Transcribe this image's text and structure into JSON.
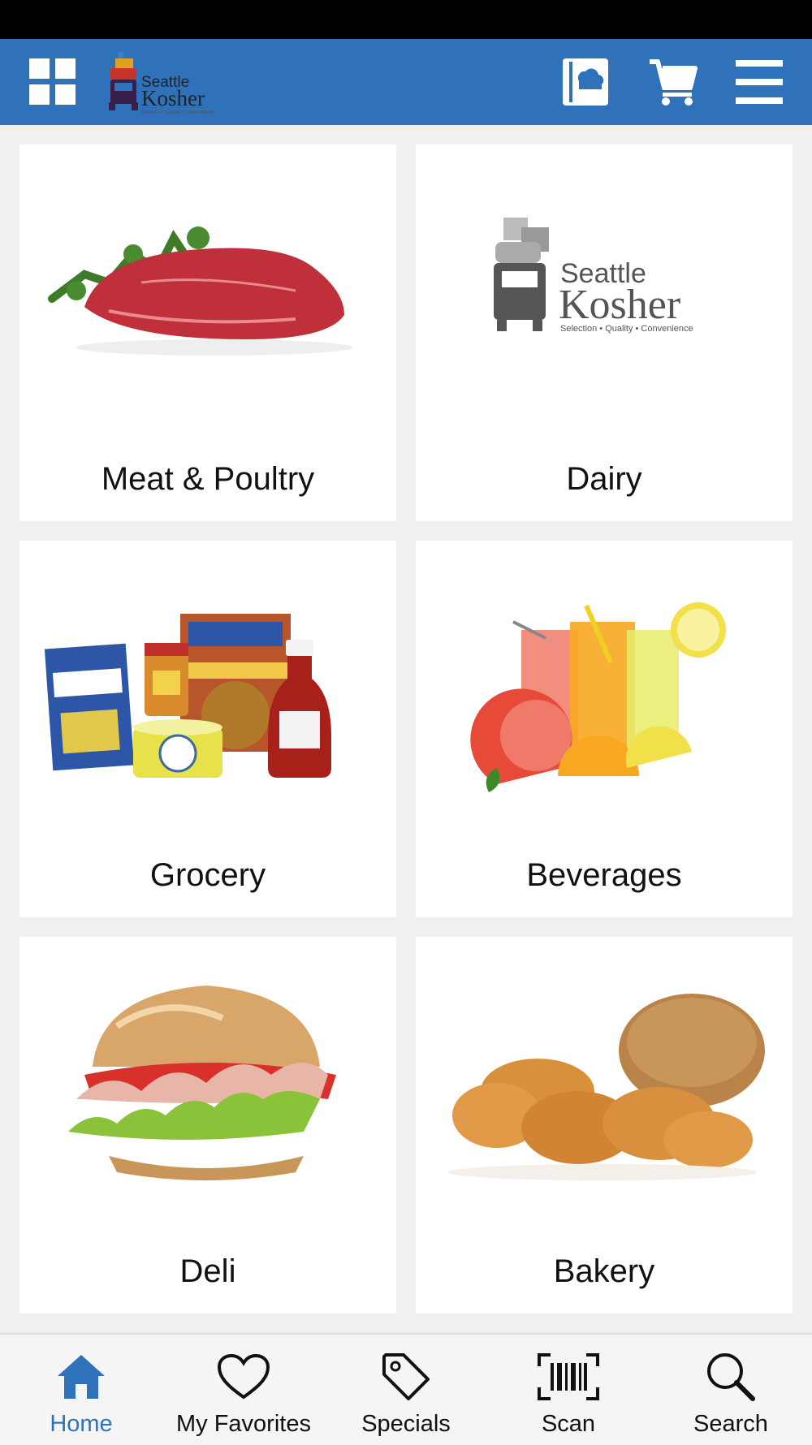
{
  "header": {
    "grid_icon": "grid-icon",
    "logo": {
      "line1": "Seattle",
      "line2": "Kosher",
      "tagline": "Selection • Quality • Convenience"
    },
    "circular_icon": "circular-icon",
    "cart_icon": "cart-icon",
    "menu_icon": "hamburger-menu-icon",
    "accent_color": "#2f72ba"
  },
  "categories": [
    {
      "label": "Meat & Poultry",
      "image": "meat-image"
    },
    {
      "label": "Dairy",
      "image": "seattle-kosher-logo",
      "logo_line1": "Seattle",
      "logo_line2": "Kosher",
      "logo_tagline": "Selection • Quality • Convenience"
    },
    {
      "label": "Grocery",
      "image": "grocery-image"
    },
    {
      "label": "Beverages",
      "image": "beverages-image"
    },
    {
      "label": "Deli",
      "image": "deli-sandwich-image"
    },
    {
      "label": "Bakery",
      "image": "bakery-bread-image"
    }
  ],
  "tabbar": {
    "active_tab": "Home",
    "tabs": [
      {
        "label": "Home",
        "icon": "home-icon"
      },
      {
        "label": "My Favorites",
        "icon": "heart-icon"
      },
      {
        "label": "Specials",
        "icon": "tag-icon"
      },
      {
        "label": "Scan",
        "icon": "barcode-scan-icon"
      },
      {
        "label": "Search",
        "icon": "search-icon"
      }
    ]
  }
}
